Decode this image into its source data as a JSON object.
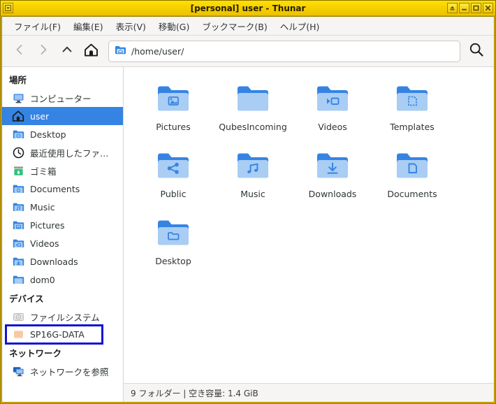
{
  "window": {
    "title": "[personal] user - Thunar",
    "border_color": "#f2c300",
    "titlebar_buttons": [
      {
        "name": "window-menu-button",
        "glyph": "menu"
      },
      {
        "name": "shade-button",
        "glyph": "shade"
      },
      {
        "name": "minimize-button",
        "glyph": "minimize"
      },
      {
        "name": "maximize-button",
        "glyph": "maximize"
      },
      {
        "name": "close-button",
        "glyph": "close"
      }
    ]
  },
  "menubar": {
    "items": [
      {
        "label": "ファイル(F)",
        "name": "menu-file"
      },
      {
        "label": "編集(E)",
        "name": "menu-edit"
      },
      {
        "label": "表示(V)",
        "name": "menu-view"
      },
      {
        "label": "移動(G)",
        "name": "menu-go"
      },
      {
        "label": "ブックマーク(B)",
        "name": "menu-bookmarks"
      },
      {
        "label": "ヘルプ(H)",
        "name": "menu-help"
      }
    ]
  },
  "toolbar": {
    "back_icon": "chevron-left-icon",
    "forward_icon": "chevron-right-icon",
    "up_icon": "chevron-up-icon",
    "home_icon": "home-icon",
    "search_icon": "search-icon",
    "path_value": "/home/user/",
    "path_icon": "home-folder-icon"
  },
  "sidebar": {
    "sections": [
      {
        "header": "場所",
        "name": "sidebar-section-places",
        "items": [
          {
            "label": "コンピューター",
            "icon": "computer-icon",
            "name": "sidebar-item-computer",
            "selected": false,
            "annotated": false
          },
          {
            "label": "user",
            "icon": "home-icon",
            "name": "sidebar-item-user",
            "selected": true,
            "annotated": false
          },
          {
            "label": "Desktop",
            "icon": "folder-desktop-icon",
            "name": "sidebar-item-desktop",
            "selected": false,
            "annotated": false
          },
          {
            "label": "最近使用したファ…",
            "icon": "clock-icon",
            "name": "sidebar-item-recent",
            "selected": false,
            "annotated": false
          },
          {
            "label": "ゴミ箱",
            "icon": "trash-icon",
            "name": "sidebar-item-trash",
            "selected": false,
            "annotated": false
          },
          {
            "label": "Documents",
            "icon": "folder-documents-icon",
            "name": "sidebar-item-documents",
            "selected": false,
            "annotated": false
          },
          {
            "label": "Music",
            "icon": "folder-music-icon",
            "name": "sidebar-item-music",
            "selected": false,
            "annotated": false
          },
          {
            "label": "Pictures",
            "icon": "folder-pictures-icon",
            "name": "sidebar-item-pictures",
            "selected": false,
            "annotated": false
          },
          {
            "label": "Videos",
            "icon": "folder-videos-icon",
            "name": "sidebar-item-videos",
            "selected": false,
            "annotated": false
          },
          {
            "label": "Downloads",
            "icon": "folder-downloads-icon",
            "name": "sidebar-item-downloads",
            "selected": false,
            "annotated": false
          },
          {
            "label": "dom0",
            "icon": "folder-icon",
            "name": "sidebar-item-dom0",
            "selected": false,
            "annotated": false
          }
        ]
      },
      {
        "header": "デバイス",
        "name": "sidebar-section-devices",
        "items": [
          {
            "label": "ファイルシステム",
            "icon": "harddisk-icon",
            "name": "sidebar-item-filesystem",
            "selected": false,
            "annotated": false
          },
          {
            "label": "SP16G-DATA",
            "icon": "usb-drive-icon",
            "name": "sidebar-item-sp16g-data",
            "selected": false,
            "annotated": true
          }
        ]
      },
      {
        "header": "ネットワーク",
        "name": "sidebar-section-network",
        "items": [
          {
            "label": "ネットワークを参照",
            "icon": "network-icon",
            "name": "sidebar-item-browse-network",
            "selected": false,
            "annotated": false
          }
        ]
      }
    ]
  },
  "main": {
    "files": [
      {
        "name": "Pictures",
        "icon": "folder-pictures-icon"
      },
      {
        "name": "QubesIncoming",
        "icon": "folder-icon"
      },
      {
        "name": "Videos",
        "icon": "folder-videos-icon"
      },
      {
        "name": "Templates",
        "icon": "folder-templates-icon"
      },
      {
        "name": "Public",
        "icon": "folder-public-icon"
      },
      {
        "name": "Music",
        "icon": "folder-music-icon"
      },
      {
        "name": "Downloads",
        "icon": "folder-downloads-icon"
      },
      {
        "name": "Documents",
        "icon": "folder-documents-icon"
      },
      {
        "name": "Desktop",
        "icon": "folder-desktop-icon"
      }
    ]
  },
  "statusbar": {
    "text": "9 フォルダー | 空き容量: 1.4 GiB"
  },
  "colors": {
    "accent": "#3584e4",
    "vm_border": "#f2c300",
    "annotation": "#1414d2",
    "folder_body": "#a9cdf3",
    "folder_tab": "#3584e4"
  }
}
